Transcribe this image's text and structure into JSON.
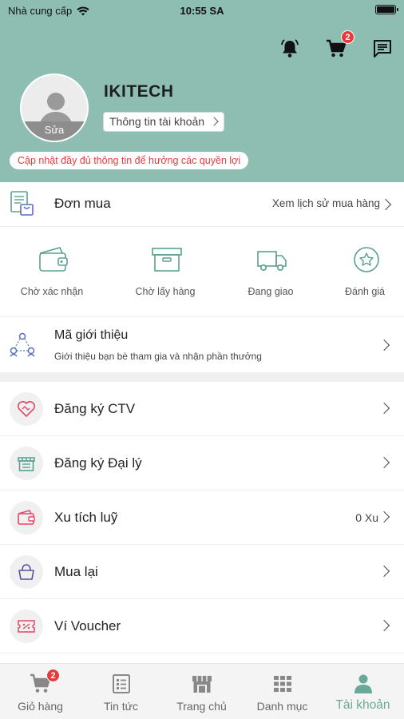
{
  "status_bar": {
    "carrier": "Nhà cung cấp",
    "time": "10:55 SA"
  },
  "header": {
    "cart_badge": "2",
    "username": "IKITECH",
    "account_info_label": "Thông tin tài khoản",
    "avatar_edit_label": "Sửa",
    "notice": "Cập nhật đầy đủ thông tin để hưởng các quyền lợi",
    "icons": [
      "bell-icon",
      "cart-icon",
      "message-icon"
    ]
  },
  "orders": {
    "title": "Đơn mua",
    "history_label": "Xem lịch sử mua hàng",
    "statuses": [
      {
        "label": "Chờ xác nhận",
        "icon": "wallet-icon"
      },
      {
        "label": "Chờ lấy hàng",
        "icon": "box-icon"
      },
      {
        "label": "Đang giao",
        "icon": "truck-icon"
      },
      {
        "label": "Đánh giá",
        "icon": "star-icon"
      }
    ]
  },
  "referral": {
    "title": "Mã giới thiệu",
    "subtitle": "Giới thiệu bạn bè tham gia và nhận phần thưởng"
  },
  "menu": [
    {
      "title": "Đăng ký CTV",
      "value": "",
      "icon": "handshake-heart-icon"
    },
    {
      "title": "Đăng ký Đại lý",
      "value": "",
      "icon": "store-icon"
    },
    {
      "title": "Xu tích luỹ",
      "value": "0 Xu",
      "icon": "wallet-icon"
    },
    {
      "title": "Mua lại",
      "value": "",
      "icon": "bag-icon"
    },
    {
      "title": "Ví Voucher",
      "value": "",
      "icon": "voucher-icon"
    }
  ],
  "bottom_nav": [
    {
      "label": "Giỏ hàng",
      "badge": "2",
      "icon": "cart-icon"
    },
    {
      "label": "Tin tức",
      "icon": "news-icon"
    },
    {
      "label": "Trang chủ",
      "icon": "shop-icon"
    },
    {
      "label": "Danh mục",
      "icon": "grid-icon"
    },
    {
      "label": "Tài khoản",
      "icon": "user-icon",
      "active": true
    }
  ],
  "colors": {
    "header_bg": "#8ebeb2",
    "accent": "#6aa99a",
    "badge": "#e53b3b"
  }
}
